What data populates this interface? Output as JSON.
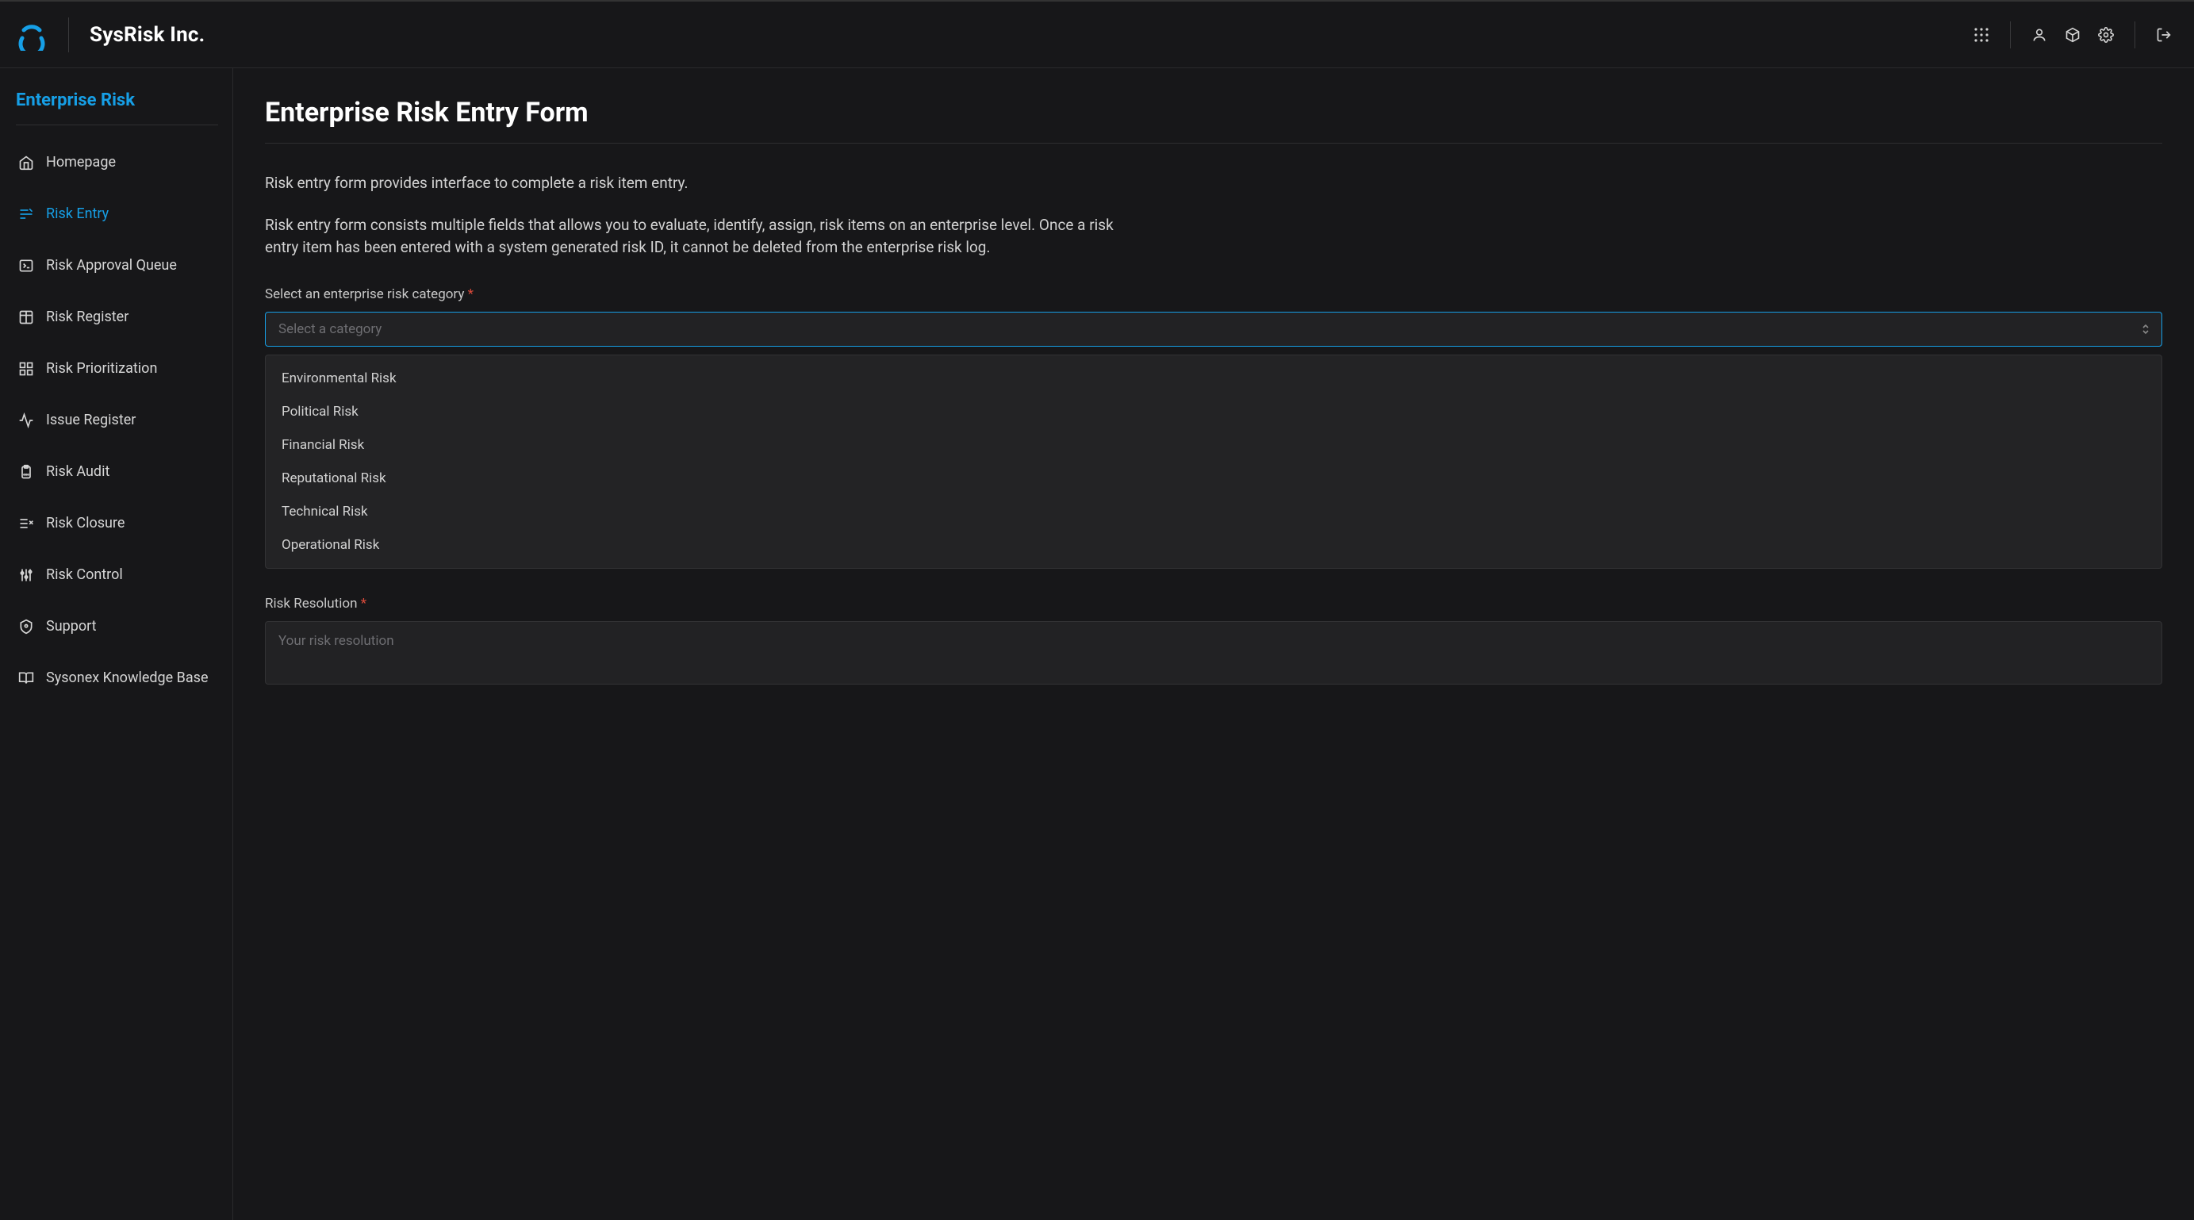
{
  "brand": "SysRisk Inc.",
  "sidebar": {
    "title": "Enterprise Risk",
    "items": [
      {
        "label": "Homepage"
      },
      {
        "label": "Risk Entry"
      },
      {
        "label": "Risk Approval Queue"
      },
      {
        "label": "Risk Register"
      },
      {
        "label": "Risk Prioritization"
      },
      {
        "label": "Issue Register"
      },
      {
        "label": "Risk Audit"
      },
      {
        "label": "Risk Closure"
      },
      {
        "label": "Risk Control"
      },
      {
        "label": "Support"
      },
      {
        "label": "Sysonex Knowledge Base"
      }
    ]
  },
  "page": {
    "title": "Enterprise Risk Entry Form",
    "desc1": "Risk entry form provides interface to complete a risk item entry.",
    "desc2": "Risk entry form consists multiple fields that allows you to evaluate, identify, assign, risk items on an enterprise level. Once a risk entry item has been entered with a system generated risk ID, it cannot be deleted from the enterprise risk log."
  },
  "form": {
    "category_label": "Select an enterprise risk category",
    "category_placeholder": "Select a category",
    "options": [
      "Environmental Risk",
      "Political Risk",
      "Financial Risk",
      "Reputational Risk",
      "Technical Risk",
      "Operational Risk"
    ],
    "resolution_label": "Risk Resolution",
    "resolution_placeholder": "Your risk resolution"
  }
}
